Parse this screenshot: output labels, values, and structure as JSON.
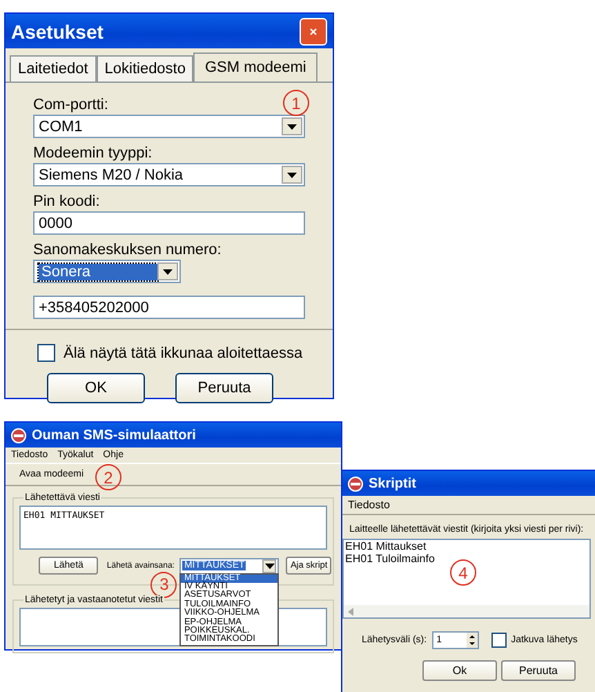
{
  "settings_dialog": {
    "title": "Asetukset",
    "callout": "1",
    "tabs": [
      {
        "label": "Laitetiedot",
        "selected": false
      },
      {
        "label": "Lokitiedosto",
        "selected": false
      },
      {
        "label": "GSM modeemi",
        "selected": true
      }
    ],
    "fields": [
      {
        "kind": "select",
        "label": "Com-portti:",
        "value": "COM1",
        "focused": false
      },
      {
        "kind": "select",
        "label": "Modeemin tyyppi:",
        "value": "Siemens M20 / Nokia",
        "focused": false
      },
      {
        "kind": "input",
        "label": "Pin koodi:",
        "value": "0000",
        "focused": false
      },
      {
        "kind": "short_select",
        "label": "Sanomakeskuksen numero:",
        "value": "Sonera",
        "focused": true
      },
      {
        "kind": "input",
        "value": "+358405202000",
        "focused": false
      }
    ],
    "checkbox": {
      "label": "Älä näytä tätä ikkunaa aloitettaessa",
      "checked": false
    },
    "buttons": [
      "OK",
      "Peruuta"
    ]
  },
  "simulator_window": {
    "title": "Ouman SMS-simulaattori",
    "menu": [
      "Tiedosto",
      "Työkalut",
      "Ohje"
    ],
    "toolbar": [
      "Avaa modeemi"
    ],
    "callouts": [
      "2",
      "3"
    ],
    "message_group": {
      "title": "Lähetettävä viesti",
      "text": "EH01 MITTAUKSET"
    },
    "send_button": "Lähetä",
    "keyword_label": "Lähetä avainsana:",
    "keyword_select": {
      "value": "MITTAUKSET",
      "expanded": true
    },
    "keyword_options": [
      {
        "label": "MITTAUKSET",
        "selected": true
      },
      {
        "label": "IV KÄYNTI",
        "selected": false
      },
      {
        "label": "ASETUSARVOT",
        "selected": false
      },
      {
        "label": "TULOILMAINFO",
        "selected": false
      },
      {
        "label": "VIIKKO-OHJELMA",
        "selected": false
      },
      {
        "label": "EP-OHJELMA",
        "selected": false
      },
      {
        "label": "POIKKEUSKAL.",
        "selected": false
      },
      {
        "label": "TOIMINTAKOODI",
        "selected": false
      }
    ],
    "script_button": "Aja skript",
    "log_group": {
      "title": "Lähetetyt ja vastaanotetut viestit"
    }
  },
  "scripts_window": {
    "title": "Skriptit",
    "menu": [
      "Tiedosto"
    ],
    "callout": "4",
    "label": "Laitteelle lähetettävät viestit (kirjoita yksi viesti per rivi):",
    "lines": [
      "EH01 Mittaukset",
      "EH01 Tuloilmainfo"
    ],
    "interval_label": "Lähetysväli (s):",
    "interval_value": "1",
    "checkbox": {
      "label": "Jatkuva lähetys",
      "checked": false
    },
    "buttons": [
      "Ok",
      "Peruuta"
    ]
  }
}
